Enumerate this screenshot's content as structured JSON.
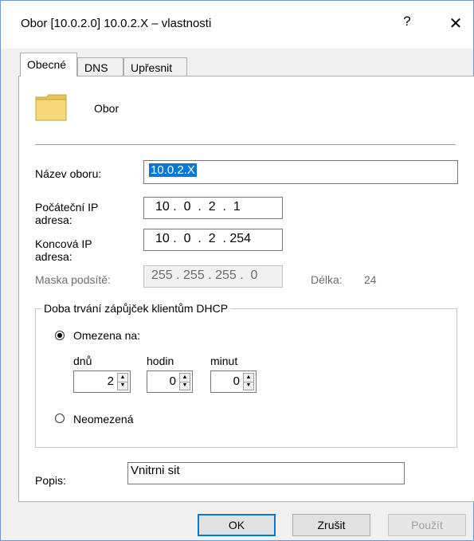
{
  "window": {
    "title": "Obor [10.0.2.0] 10.0.2.X – vlastnosti",
    "help_label": "?",
    "close_label": "✕"
  },
  "tabs": [
    {
      "label": "Obecné",
      "active": true
    },
    {
      "label": "DNS",
      "active": false
    },
    {
      "label": "Upřesnit",
      "active": false
    }
  ],
  "header": {
    "icon": "folder-icon",
    "label": "Obor"
  },
  "fields": {
    "scope_name_label": "Název oboru:",
    "scope_name_value": "10.0.2.X",
    "start_ip_label_1": "Počáteční IP",
    "start_ip_label_2": "adresa:",
    "start_ip_value": "10 .  0  .  2  .  1",
    "end_ip_label_1": "Koncová IP",
    "end_ip_label_2": "adresa:",
    "end_ip_value": "10 .  0  .  2  . 254",
    "mask_label": "Maska podsítě:",
    "mask_value": "255 . 255 . 255 .  0",
    "length_label": "Délka:",
    "length_value": "24"
  },
  "lease": {
    "group_title": "Doba trvání zápůjček klientům DHCP",
    "limited_label": "Omezena na:",
    "days_label": "dnů",
    "hours_label": "hodin",
    "minutes_label": "minut",
    "days_value": "2",
    "hours_value": "0",
    "minutes_value": "0",
    "unlimited_label": "Neomezená",
    "selected": "limited"
  },
  "description": {
    "label": "Popis:",
    "value": "Vnitrni sit"
  },
  "buttons": {
    "ok": "OK",
    "cancel": "Zrušit",
    "apply": "Použít"
  },
  "colors": {
    "accent": "#0078d7",
    "window_border": "#6c9bd2"
  }
}
